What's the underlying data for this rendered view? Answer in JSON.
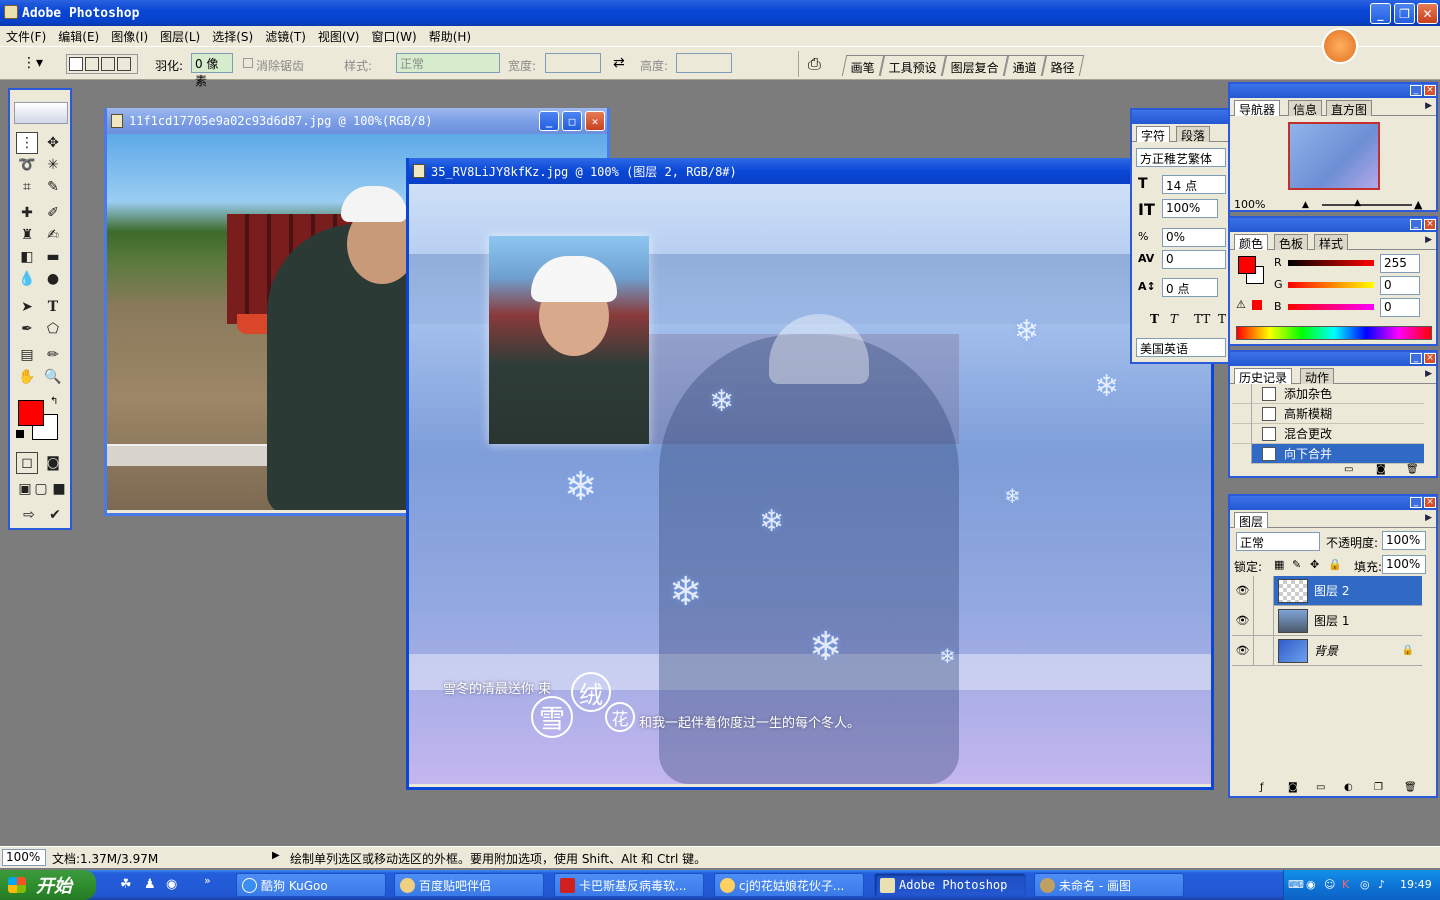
{
  "app": {
    "title": "Adobe Photoshop"
  },
  "menu": [
    "文件(F)",
    "编辑(E)",
    "图像(I)",
    "图层(L)",
    "选择(S)",
    "滤镜(T)",
    "视图(V)",
    "窗口(W)",
    "帮助(H)"
  ],
  "options": {
    "feather_label": "羽化:",
    "feather_value": "0 像素",
    "antialias_label": "消除锯齿",
    "style_label": "样式:",
    "style_value": "正常",
    "width_label": "宽度:",
    "height_label": "高度:"
  },
  "palette_well": [
    "画笔",
    "工具预设",
    "图层复合",
    "通道",
    "路径"
  ],
  "doc1": {
    "title": "11f1cd17705e9a02c93d6d87.jpg @ 100%(RGB/8)"
  },
  "doc2": {
    "title": "35_RV8LiJY8kfKz.jpg @ 100% (图层 2, RGB/8#)",
    "caption1": "雪冬的清晨送你  束",
    "caption2": "和我一起伴着你度过一生的每个冬人。",
    "char_xue": "雪",
    "char_rong": "绒",
    "char_hua": "花"
  },
  "character_panel": {
    "tabs": [
      "字符",
      "段落"
    ],
    "font": "方正稚艺繁体",
    "size": "14 点",
    "vscale": "100%",
    "tracking_pct": "0%",
    "kerning": "0",
    "baseline": "0 点",
    "style_buttons": [
      "T",
      "T",
      "TT",
      "T"
    ],
    "language": "美国英语"
  },
  "navigator_panel": {
    "tabs": [
      "导航器",
      "信息",
      "直方图"
    ],
    "zoom": "100%"
  },
  "color_panel": {
    "tabs": [
      "颜色",
      "色板",
      "样式"
    ],
    "r_label": "R",
    "r": "255",
    "g_label": "G",
    "g": "0",
    "b_label": "B",
    "b": "0",
    "fg_color": "#ff0000"
  },
  "history_panel": {
    "tabs": [
      "历史记录",
      "动作"
    ],
    "items": [
      "添加杂色",
      "高斯模糊",
      "混合更改",
      "向下合并"
    ]
  },
  "layers_panel": {
    "tab": "图层",
    "blend": "正常",
    "opacity_label": "不透明度:",
    "opacity": "100%",
    "lock_label": "锁定:",
    "fill_label": "填充:",
    "fill": "100%",
    "layers": [
      "图层 2",
      "图层 1",
      "背景"
    ]
  },
  "status": {
    "zoom": "100%",
    "doc": "文档:1.37M/3.97M",
    "hint": "绘制单列选区或移动选区的外框。要用附加选项，使用 Shift、Alt 和 Ctrl 键。"
  },
  "taskbar": {
    "start": "开始",
    "tasks": [
      "酷狗 KuGoo",
      "百度贴吧伴侣",
      "卡巴斯基反病毒软...",
      "cj的花姑娘花伙子...",
      "Adobe Photoshop",
      "未命名 - 画图"
    ],
    "clock": "19:49"
  }
}
